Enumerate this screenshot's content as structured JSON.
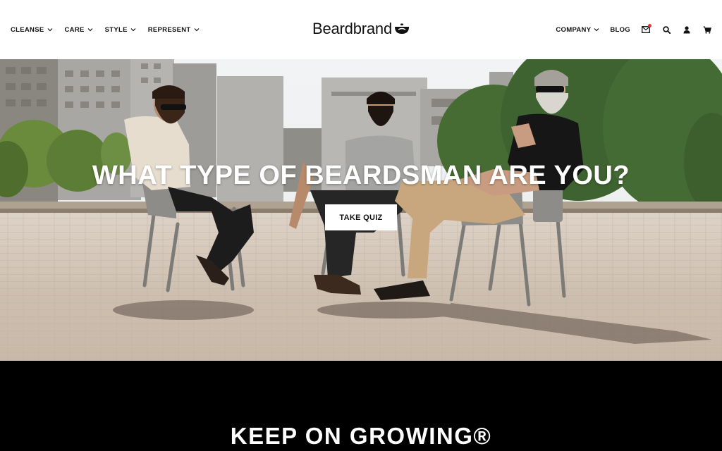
{
  "header": {
    "nav_left": [
      {
        "label": "CLEANSE"
      },
      {
        "label": "CARE"
      },
      {
        "label": "STYLE"
      },
      {
        "label": "REPRESENT"
      }
    ],
    "logo_text": "Beardbrand",
    "nav_right": {
      "company": "COMPANY",
      "blog": "BLOG"
    },
    "icons": [
      "mail-icon",
      "search-icon",
      "account-icon",
      "cart-icon"
    ],
    "notification_color": "#e0322e"
  },
  "hero": {
    "title": "WHAT TYPE OF BEARDSMAN ARE YOU?",
    "cta_label": "TAKE QUIZ"
  },
  "band": {
    "title": "KEEP ON GROWING®"
  },
  "colors": {
    "header_bg": "#ffffff",
    "band_bg": "#000000",
    "text": "#111111"
  }
}
